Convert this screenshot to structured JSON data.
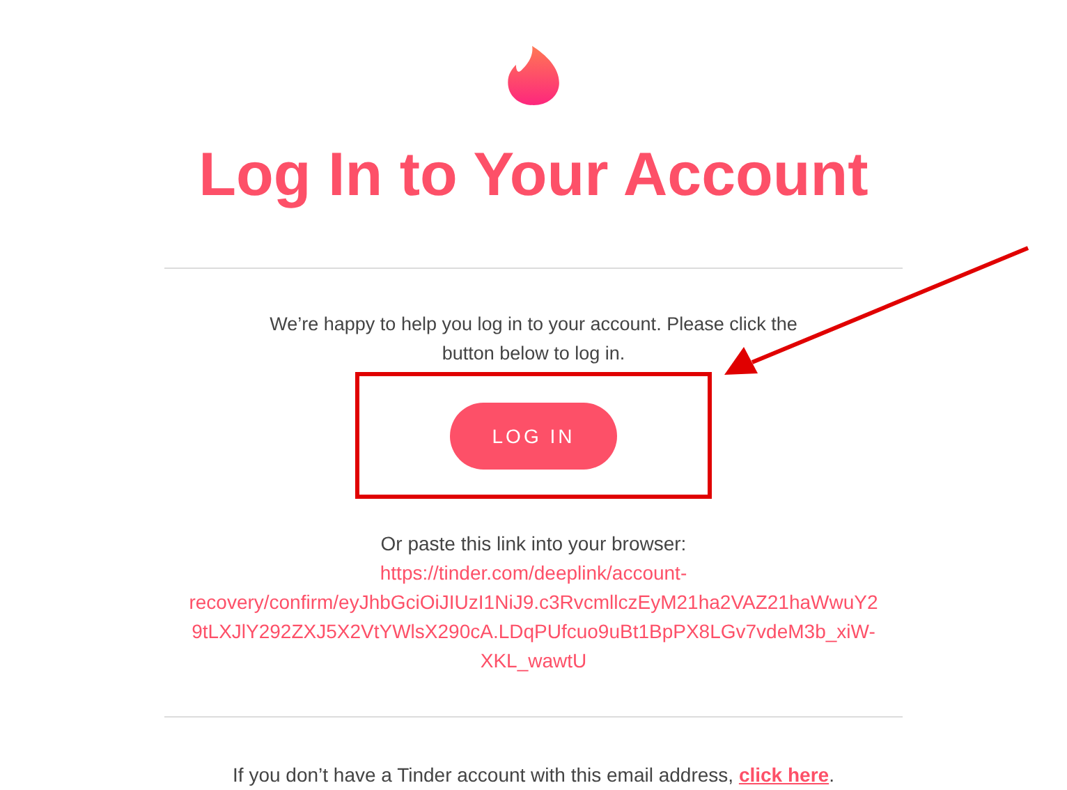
{
  "title": "Log In to Your Account",
  "intro": "We’re happy to help you log in to your account. Please click the button below to log in.",
  "login_button": "LOG IN",
  "paste_text": "Or paste this link into your browser: ",
  "recovery_link": "https://tinder.com/deeplink/account-recovery/confirm/eyJhbGciOiJIUzI1NiJ9.c3RvcmllczEyM21ha2VAZ21haWwuY29tLXJlY292ZXJ5X2VtYWlsX290cA.LDqPUfcuo9uBt1BpPX8LGv7vdeM3b_xiW-XKL_wawtU",
  "footer_text": "If you don’t have a Tinder account with this email address, ",
  "footer_link": "click here",
  "footer_end": "."
}
